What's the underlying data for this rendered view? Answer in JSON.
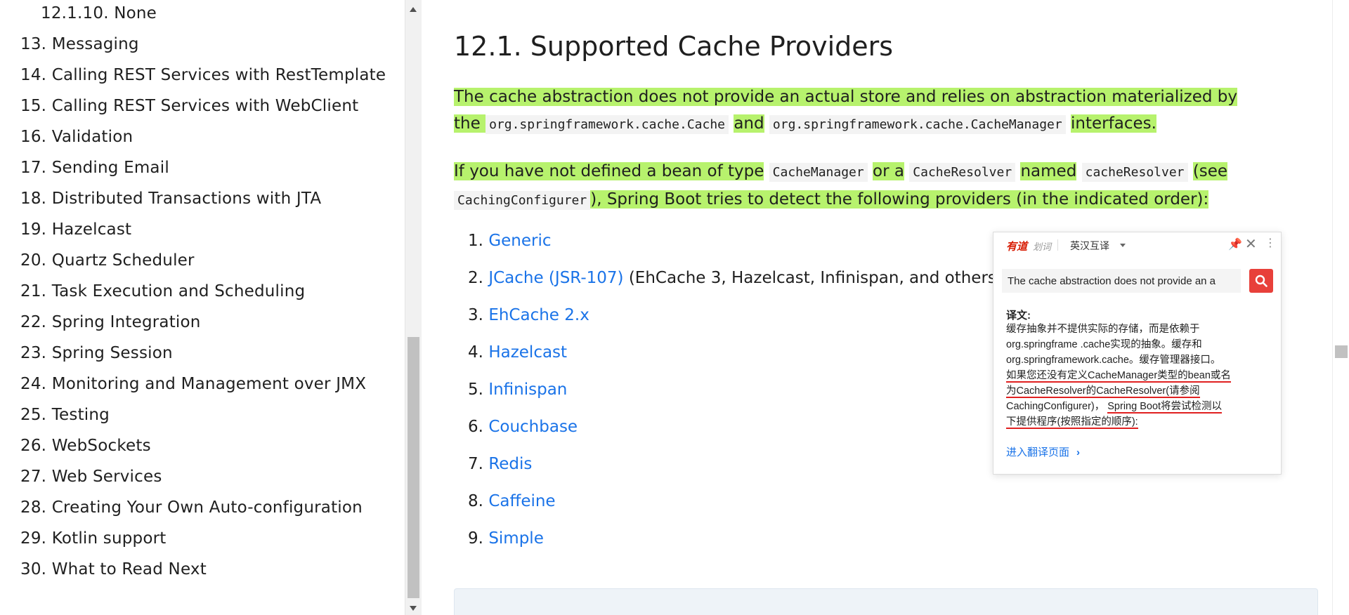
{
  "toc": {
    "items": [
      "12.1.10. None",
      "13. Messaging",
      "14. Calling REST Services with RestTemplate",
      "15. Calling REST Services with WebClient",
      "16. Validation",
      "17. Sending Email",
      "18. Distributed Transactions with JTA",
      "19. Hazelcast",
      "20. Quartz Scheduler",
      "21. Task Execution and Scheduling",
      "22. Spring Integration",
      "23. Spring Session",
      "24. Monitoring and Management over JMX",
      "25. Testing",
      "26. WebSockets",
      "27. Web Services",
      "28. Creating Your Own Auto-configuration",
      "29. Kotlin support",
      "30. What to Read Next"
    ]
  },
  "main": {
    "title": "12.1. Supported Cache Providers",
    "para1": {
      "t1": "The cache abstraction does not provide an actual store and relies on abstraction materialized by the",
      "c1": "org.springframework.cache.Cache",
      "t2": "and",
      "c2": "org.springframework.cache.CacheManager",
      "t3": "interfaces."
    },
    "para2": {
      "t1": "If you have not defined a bean of type",
      "c1": "CacheManager",
      "t2": "or a",
      "c2": "CacheResolver",
      "t3": "named",
      "c3": "cacheResolver",
      "t4": "(see",
      "c4": "CachingConfigurer",
      "t5": "), Spring Boot tries to detect the following providers (in the indicated order):"
    },
    "providers": [
      {
        "num": "1.",
        "label": "Generic",
        "note": ""
      },
      {
        "num": "2.",
        "label": "JCache (JSR-107)",
        "note": "(EhCache 3, Hazelcast, Infinispan, and others)"
      },
      {
        "num": "3.",
        "label": "EhCache 2.x",
        "note": ""
      },
      {
        "num": "4.",
        "label": "Hazelcast",
        "note": ""
      },
      {
        "num": "5.",
        "label": "Infinispan",
        "note": ""
      },
      {
        "num": "6.",
        "label": "Couchbase",
        "note": ""
      },
      {
        "num": "7.",
        "label": "Redis",
        "note": ""
      },
      {
        "num": "8.",
        "label": "Caffeine",
        "note": ""
      },
      {
        "num": "9.",
        "label": "Simple",
        "note": ""
      }
    ]
  },
  "popup": {
    "brand": "有道",
    "brand_sub": "划词",
    "lang_mode": "英汉互译",
    "input_value": "The cache abstraction does not provide an a",
    "translation_label": "译文:",
    "lines": {
      "l1": "缓存抽象并不提供实际的存储，而是依赖于",
      "l2": "org.springframe .cache实现的抽象。缓存和",
      "l3": "org.springframework.cache。缓存管理器接口。",
      "l4": "如果您还没有定义CacheManager类型的bean或名",
      "l5": "为CacheResolver的CacheResolver(请参阅",
      "l6a": "CachingConfigurer)，",
      "l6b": "Spring Boot将尝试检测以",
      "l7": "下提供程序(按照指定的顺序):"
    },
    "link": "进入翻译页面",
    "colors": {
      "accent": "#e8403a",
      "underline": "#e02020",
      "link": "#1a73e8"
    }
  },
  "colors": {
    "highlight": "#b7f26d",
    "link": "#1a73e8"
  }
}
